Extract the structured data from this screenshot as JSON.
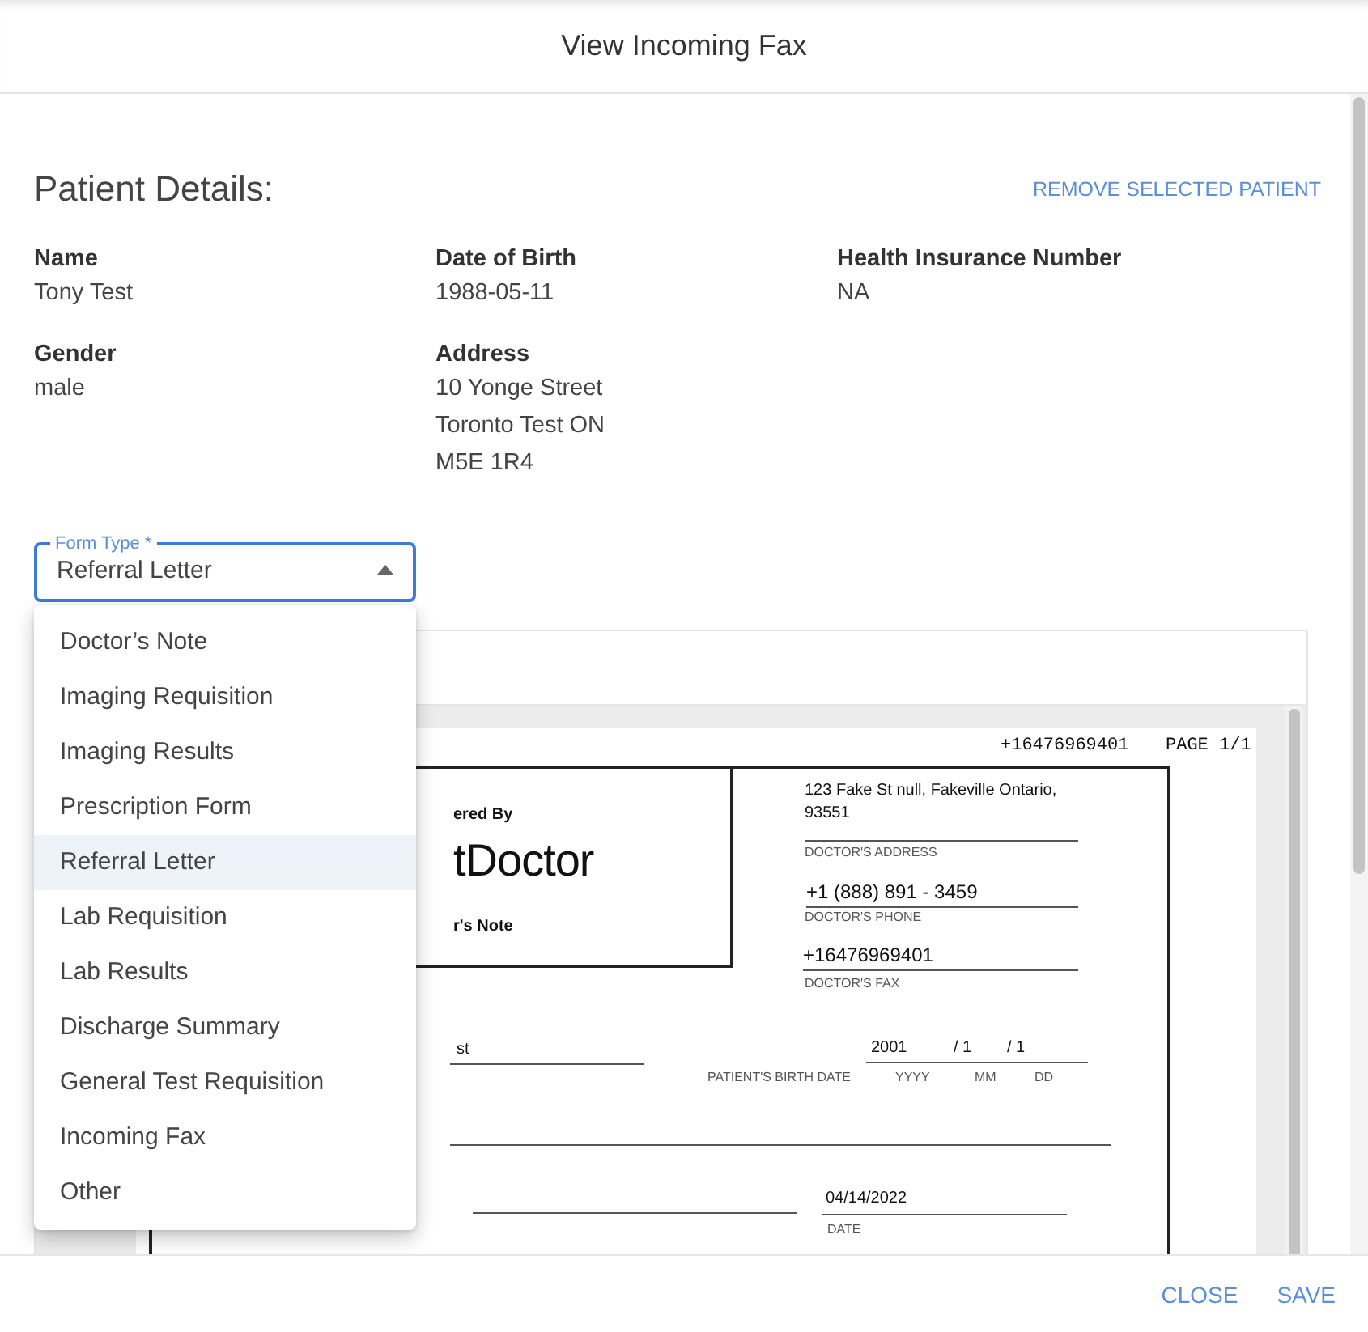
{
  "window": {
    "title": "View Incoming Fax"
  },
  "patient": {
    "heading": "Patient Details:",
    "remove_action": "REMOVE SELECTED PATIENT",
    "fields": [
      {
        "label": "Name",
        "lines": [
          "Tony Test"
        ]
      },
      {
        "label": "Date of Birth",
        "lines": [
          "1988-05-11"
        ]
      },
      {
        "label": "Health Insurance Number",
        "lines": [
          "NA"
        ]
      },
      {
        "label": "Gender",
        "lines": [
          "male"
        ]
      },
      {
        "label": "Address",
        "lines": [
          "10 Yonge Street",
          "Toronto Test ON",
          "M5E 1R4"
        ]
      }
    ]
  },
  "form_type": {
    "label": "Form Type *",
    "value": "Referral Letter",
    "expanded": true,
    "options": [
      {
        "label": "Doctor’s Note",
        "selected": false
      },
      {
        "label": "Imaging Requisition",
        "selected": false
      },
      {
        "label": "Imaging Results",
        "selected": false
      },
      {
        "label": "Prescription Form",
        "selected": false
      },
      {
        "label": "Referral Letter",
        "selected": true
      },
      {
        "label": "Lab Requisition",
        "selected": false
      },
      {
        "label": "Lab Results",
        "selected": false
      },
      {
        "label": "Discharge Summary",
        "selected": false
      },
      {
        "label": "General Test Requisition",
        "selected": false
      },
      {
        "label": "Incoming Fax",
        "selected": false
      },
      {
        "label": "Other",
        "selected": false
      }
    ]
  },
  "fax_document": {
    "fax_number": "+16476969401",
    "page": "PAGE 1/1",
    "powered_by": "ered By",
    "logo": "tDoctor",
    "note_title": "r's Note",
    "doctor_address": [
      "123 Fake St null, Fakeville Ontario,",
      "93551"
    ],
    "address_caption": "DOCTOR'S ADDRESS",
    "doctor_phone": "+1 (888) 891 - 3459",
    "phone_caption": "DOCTOR'S PHONE",
    "doctor_fax": "+16476969401",
    "fax_caption": "DOCTOR'S FAX",
    "patient_name": "st",
    "birth_year": "2001",
    "birth_month": "/ 1",
    "birth_day": "/ 1",
    "birth_caption": "PATIENT'S BIRTH DATE",
    "year_caption": "YYYY",
    "month_caption": "MM",
    "day_caption": "DD",
    "date": "04/14/2022",
    "date_caption": "DATE"
  },
  "buttons": [
    "CLOSE",
    "SAVE"
  ]
}
